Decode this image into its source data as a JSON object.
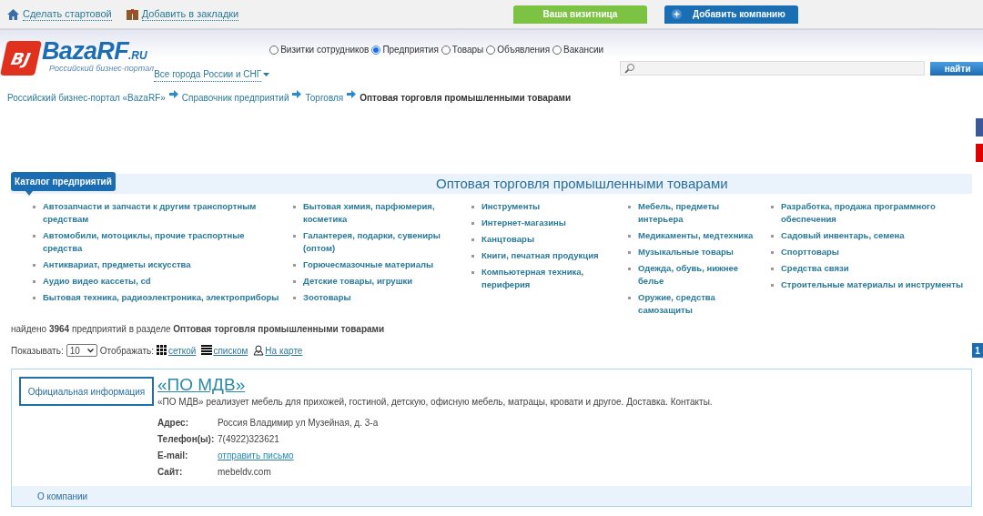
{
  "top_links": [
    "Сделать стартовой",
    "Добавить в закладки"
  ],
  "top_buttons": [
    {
      "label": "Ваша визитница",
      "kind": "green"
    },
    {
      "label": "Добавить компанию",
      "kind": "blue"
    }
  ],
  "logo": {
    "mark": "BJ",
    "name": "BazaRF",
    "suffix": ".RU",
    "tagline": "Российский бизнес-портал"
  },
  "region_link": "Все города России и СНГ",
  "search_types": [
    {
      "label": "Визитки сотрудников",
      "selected": false
    },
    {
      "label": "Предприятия",
      "selected": true
    },
    {
      "label": "Товары",
      "selected": false
    },
    {
      "label": "Объявления",
      "selected": false
    },
    {
      "label": "Вакансии",
      "selected": false
    }
  ],
  "search": {
    "button": "найти"
  },
  "breadcrumbs": [
    {
      "label": "Российский бизнес-портал «BazaRF»",
      "current": false
    },
    {
      "label": "Справочник предприятий",
      "current": false
    },
    {
      "label": "Торговля",
      "current": false
    },
    {
      "label": "Оптовая торговля промышленными товарами",
      "current": true
    }
  ],
  "catalog": {
    "tab": "Каталог предприятий",
    "title": "Оптовая торговля промышленными товарами",
    "columns": [
      [
        "Автозапчасти и запчасти к другим транспортным средствам",
        "Автомобили, мотоциклы, прочие траспортные средства",
        "Антиквариат, предметы искусства",
        "Аудио видео кассеты, cd",
        "Бытовая техника, радиоэлектроника, электроприборы"
      ],
      [
        "Бытовая химия, парфюмерия, косметика",
        "Галантерея, подарки, сувениры (оптом)",
        "Горючесмазочные материалы",
        "Детские товары, игрушки",
        "Зоотовары"
      ],
      [
        "Инструменты",
        "Интернет-магазины",
        "Канцтовары",
        "Книги, печатная продукция",
        "Компьютерная техника, периферия"
      ],
      [
        "Мебель, предметы интерьера",
        "Медикаменты, медтехника",
        "Музыкальные товары",
        "Одежда, обувь, нижнее белье",
        "Оружие, средства самозащиты"
      ],
      [
        "Разработка, продажа программного обеспечения",
        "Садовый инвентарь, семена",
        "Спорттовары",
        "Средства связи",
        "Строительные материалы и инструменты"
      ]
    ]
  },
  "found": "найдено **3964** предприятий в разделе **Оптовая торговля промышленными товарами**",
  "controls": {
    "show_label": "Показывать:",
    "show_value": "10",
    "display_label": "Отображать:",
    "views": [
      {
        "label": "сеткой",
        "kind": "grid"
      },
      {
        "label": "списком",
        "kind": "list"
      },
      {
        "label": "На карте",
        "kind": "map"
      }
    ]
  },
  "pagination": [
    {
      "label": "1",
      "selected": true
    }
  ],
  "company": {
    "badge": "Официальная информация",
    "name": "«ПО МДВ»",
    "description": "«ПО МДВ» реализует мебель для прихожей, гостиной, детскую, офисную мебель, матрацы, кровати и другое. Доставка. Контакты.",
    "fields": [
      {
        "label": "Адрес:",
        "value": "Россия Владимир ул Музейная, д. 3-а",
        "kind": "text"
      },
      {
        "label": "Телефон(ы):",
        "value": "7(4922)323621",
        "kind": "text"
      },
      {
        "label": "E-mail:",
        "value": "отправить письмо",
        "kind": "link"
      },
      {
        "label": "Сайт:",
        "value": "mebeldv.com",
        "kind": "text"
      }
    ],
    "footer_link": "О компании"
  }
}
